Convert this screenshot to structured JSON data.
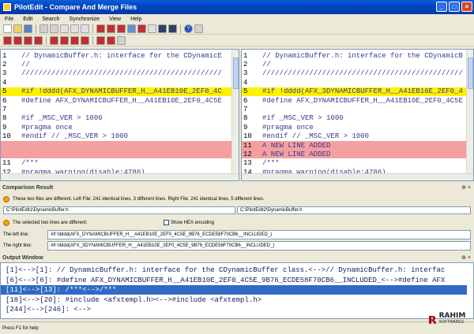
{
  "window": {
    "title": "PilotEdit - Compare And Merge Files"
  },
  "menu": [
    "File",
    "Edit",
    "Search",
    "Synchronize",
    "View",
    "Help"
  ],
  "left_pane": {
    "rows": [
      {
        "n": "1",
        "t": "// DynamicBuffer.h: interface for the CDynamicE",
        "hl": ""
      },
      {
        "n": "2",
        "t": "//",
        "hl": ""
      },
      {
        "n": "3",
        "t": "///////////////////////////////////////////////",
        "hl": ""
      },
      {
        "n": "4",
        "t": "",
        "hl": ""
      },
      {
        "n": "5",
        "t": "#if !dddd(AFX_DYNAMICBUFFER_H__A41EB10E_2EF0_4C",
        "hl": "yellow"
      },
      {
        "n": "6",
        "t": "#define AFX_DYNAMICBUFFER_H__A41EB10E_2EF0_4C5E",
        "hl": ""
      },
      {
        "n": "7",
        "t": "",
        "hl": ""
      },
      {
        "n": "8",
        "t": "#if _MSC_VER > 1000",
        "hl": ""
      },
      {
        "n": "9",
        "t": "#pragma once",
        "hl": ""
      },
      {
        "n": "10",
        "t": "#endif // _MSC_VER > 1000",
        "hl": ""
      },
      {
        "n": "",
        "t": "",
        "hl": "red"
      },
      {
        "n": "",
        "t": "",
        "hl": "red"
      },
      {
        "n": "11",
        "t": "/***",
        "hl": ""
      },
      {
        "n": "12",
        "t": "#pragma warning(disable:4786)",
        "hl": ""
      }
    ]
  },
  "right_pane": {
    "rows": [
      {
        "n": "1",
        "t": "// DynamicBuffer.h: interface for the CDynamicB",
        "hl": ""
      },
      {
        "n": "2",
        "t": "//",
        "hl": ""
      },
      {
        "n": "3",
        "t": "///////////////////////////////////////////////",
        "hl": ""
      },
      {
        "n": "4",
        "t": "",
        "hl": ""
      },
      {
        "n": "5",
        "t": "#if !dddd(AFX_3DYNAMICBUFFER_H__A41EB10E_2EF0_4",
        "hl": "yellow"
      },
      {
        "n": "6",
        "t": "#define AFX_DYNAMICBUFFER_H__A41EB10E_2EF0_4C5E",
        "hl": ""
      },
      {
        "n": "7",
        "t": "",
        "hl": ""
      },
      {
        "n": "8",
        "t": "#if _MSC_VER > 1000",
        "hl": ""
      },
      {
        "n": "9",
        "t": "#pragma once",
        "hl": ""
      },
      {
        "n": "10",
        "t": "#endif // _MSC_VER > 1000",
        "hl": ""
      },
      {
        "n": "11",
        "t": "A NEW LINE ADDED",
        "hl": "red"
      },
      {
        "n": "12",
        "t": "A NEW LINE ADDED",
        "hl": "red"
      },
      {
        "n": "13",
        "t": "/***",
        "hl": ""
      },
      {
        "n": "14",
        "t": "#pragma warning(disable:4786)",
        "hl": ""
      }
    ]
  },
  "comparison": {
    "header": "Comparison Result",
    "summary": "These two files are different. Left File: 241 identical lines, 3 different lines. Right File: 241 identical lines, 5 different lines.",
    "left_path": "C:\\PilotEdit1\\DynamicBuffer.h",
    "right_path": "C:\\PilotEdit2\\DynamicBuffer.h",
    "selected_msg": "The selected two lines are different:",
    "hex_label": "Show HEX encoding",
    "left_line_label": "The left line:",
    "left_line": "#if !dddd(AFX_DYNAMICBUFFER_H__A41EB10E_2EF0_4C5E_9B76_ECDE58F70CB6__INCLUDED_)",
    "right_line_label": "The right line:",
    "right_line": "#if !dddd(AFX_3DYNAMICBUFFER_H__A41EB10E_2EF0_4C5E_9B76_ECDE58F70CB6__INCLUDED_)"
  },
  "output": {
    "header": "Output Window",
    "rows": [
      "[1]<-->[1]: // DynamicBuffer.h: interface for the CDynamicBuffer class.<-->// DynamicBuffer.h: interfac",
      "[6]<-->[6]: #define AFX_DYNAMICBUFFER_H__A41EB10E_2EF0_4C5E_9B76_ECDE58F70CB6__INCLUDED_<-->#define AFX",
      "[11]<-->[13]: /***<-->/***",
      "[18]<-->[20]: #include <afxtempl.h><-->#include <afxtempl.h>",
      "[244]<-->[246]: <-->"
    ]
  },
  "status": {
    "text": "Press F1 for help"
  },
  "logo": {
    "name": "RAHIM",
    "sub": "SOFTWARES"
  }
}
